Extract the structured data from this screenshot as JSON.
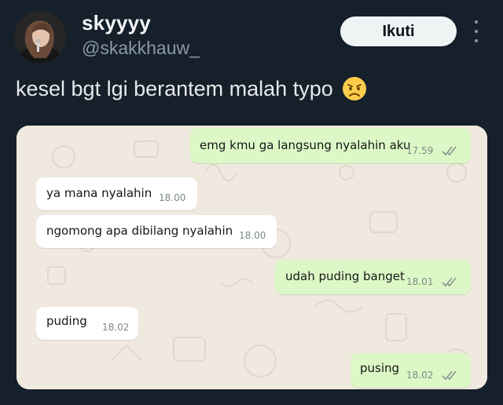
{
  "tweet": {
    "display_name": "skyyyy",
    "handle": "@skakkhauw_",
    "follow_label": "Ikuti",
    "text": "kesel bgt lgi berantem malah typo",
    "text_emoji": "disappointed-face-emoji"
  },
  "icons": {
    "more": "more-vertical-icon",
    "read_receipt": "double-check-icon"
  },
  "colors": {
    "background": "#15202b",
    "outgoing_bubble": "#dcf8c6",
    "incoming_bubble": "#ffffff",
    "chat_wallpaper": "#efe9df"
  },
  "chat": {
    "messages": [
      {
        "direction": "outgoing",
        "text": "emg kmu ga langsung nyalahin aku",
        "time": "17.59",
        "read": true
      },
      {
        "direction": "incoming",
        "text": "ya mana nyalahin",
        "time": "18.00"
      },
      {
        "direction": "incoming",
        "text": "ngomong apa dibilang nyalahin",
        "time": "18.00"
      },
      {
        "direction": "outgoing",
        "text": "udah puding banget",
        "time": "18.01",
        "read": true
      },
      {
        "direction": "incoming",
        "text": "puding",
        "time": "18.02"
      },
      {
        "direction": "outgoing",
        "text": "pusing",
        "time": "18.02",
        "read": true
      }
    ]
  }
}
